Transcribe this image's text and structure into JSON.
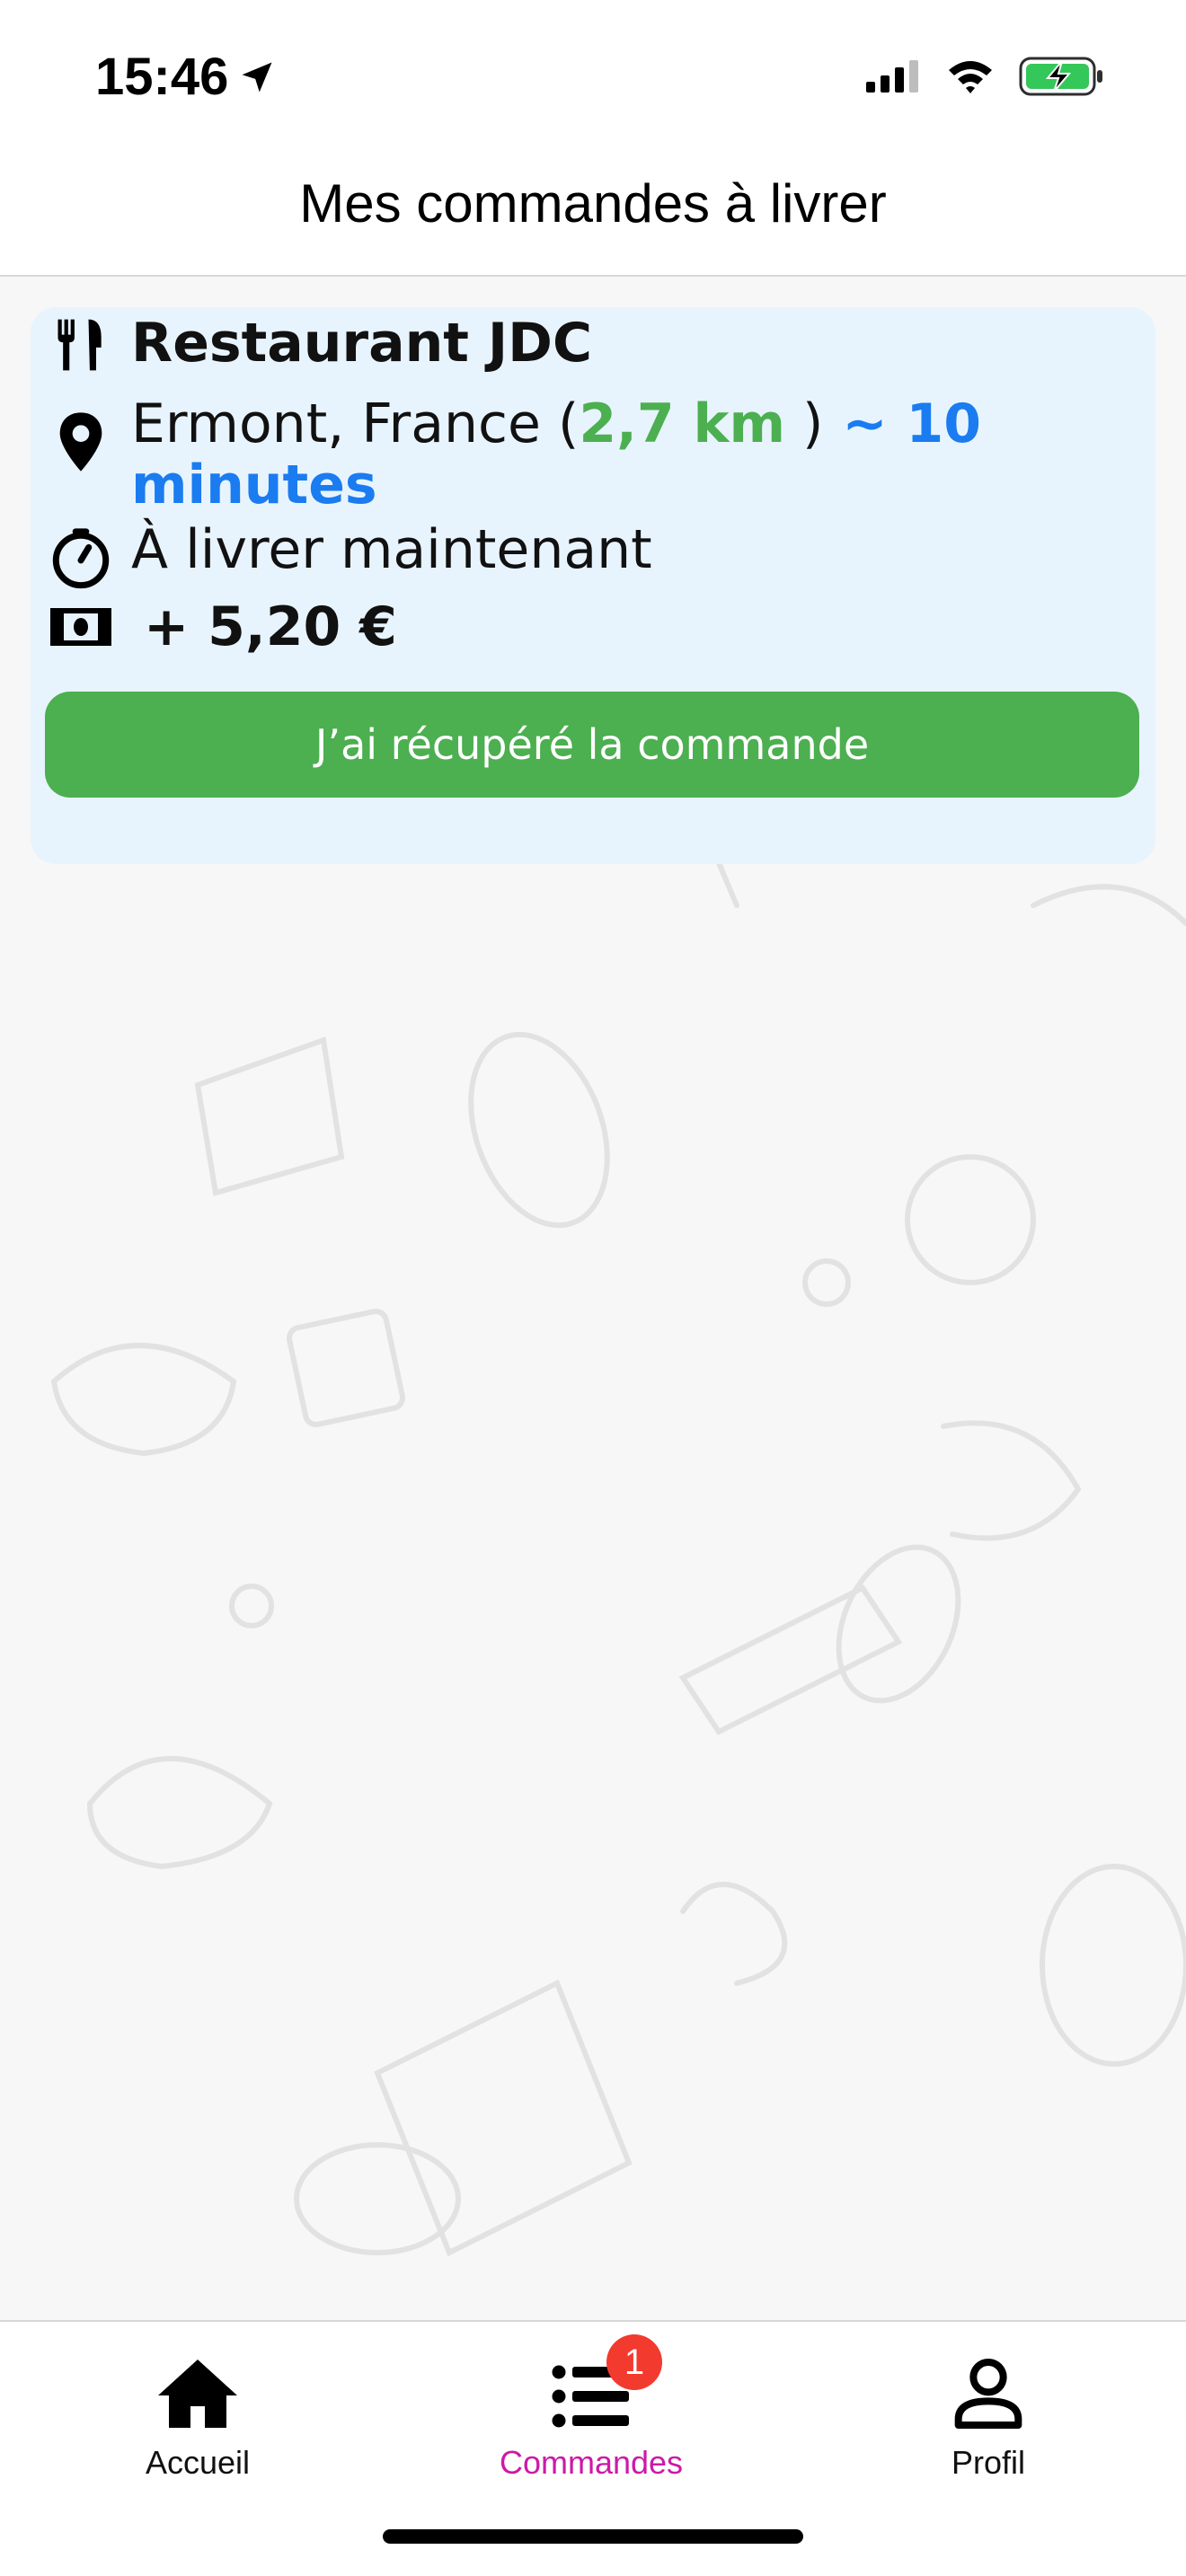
{
  "status_bar": {
    "time": "15:46"
  },
  "header": {
    "title": "Mes commandes à livrer"
  },
  "order": {
    "restaurant": "Restaurant JDC",
    "location_prefix": "Ermont, France (",
    "distance": "2,7 km",
    "location_suffix": " )",
    "duration": " ~ 10 minutes",
    "timing": "À livrer maintenant",
    "earnings": "+ 5,20 €",
    "pickup_button": "J’ai récupéré la commande"
  },
  "tabs": [
    {
      "label": "Accueil",
      "icon": "home-icon"
    },
    {
      "label": "Commandes",
      "icon": "list-icon",
      "badge": "1",
      "active": true
    },
    {
      "label": "Profil",
      "icon": "person-icon"
    }
  ],
  "colors": {
    "accent_green": "#4caf50",
    "accent_blue": "#1a7cf0",
    "card_bg": "#e8f4fd",
    "active_tab": "#cc1aa7",
    "badge": "#f23a2f"
  }
}
